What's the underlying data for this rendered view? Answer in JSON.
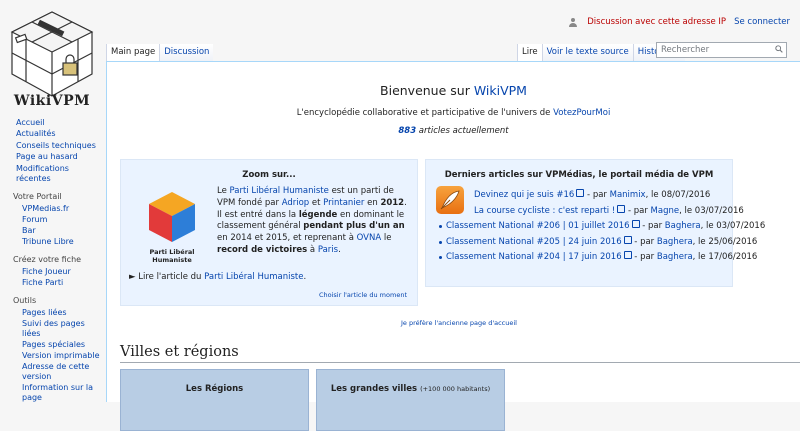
{
  "logo": {
    "wordmark": "WikiVPM"
  },
  "personal": {
    "ip_talk": "Discussion avec cette adresse IP",
    "login": "Se connecter"
  },
  "tabs_left": [
    "Main page",
    "Discussion"
  ],
  "tabs_right": [
    "Lire",
    "Voir le texte source",
    "Historique"
  ],
  "search": {
    "placeholder": "Rechercher"
  },
  "sidebar": {
    "nav": [
      "Accueil",
      "Actualités",
      "Conseils techniques",
      "Page au hasard",
      "Modifications récentes"
    ],
    "portail": {
      "heading": "Votre Portail",
      "items": [
        "VPMedias.fr",
        "Forum",
        "Bar",
        "Tribune Libre"
      ]
    },
    "fiche": {
      "heading": "Créez votre fiche",
      "items": [
        "Fiche Joueur",
        "Fiche Parti"
      ]
    },
    "outils": {
      "heading": "Outils",
      "items": [
        "Pages liées",
        "Suivi des pages liées",
        "Pages spéciales",
        "Version imprimable",
        "Adresse de cette version",
        "Information sur la page"
      ]
    }
  },
  "main": {
    "welcome_prefix": "Bienvenue sur ",
    "welcome_link": "WikiVPM",
    "tagline_prefix": "L'encyclopédie collaborative et participative de l'univers de ",
    "tagline_link": "VotezPourMoi",
    "count_number": "883",
    "count_suffix": " articles actuellement"
  },
  "zoom": {
    "title": "Zoom sur...",
    "logo_caption": "Parti Libéral Humaniste",
    "t1": "Le ",
    "party": "Parti Libéral Humaniste",
    "t2": " est un parti de VPM fondé par ",
    "founder1": "Adriop",
    "t3": " et ",
    "founder2": "Printanier",
    "t4": " en ",
    "year": "2012",
    "t5": ". Il est entré dans la ",
    "legende": "légende",
    "t6": " en dominant le classement général ",
    "duration": "pendant plus d'un an",
    "t7": " en 2014 et 2015, et reprenant à ",
    "ovna": "OVNA",
    "t8": " le ",
    "record": "record de victoires",
    "t9": " à ",
    "paris": "Paris",
    "t10": ".",
    "more_prefix": "► Lire l'article du ",
    "more_link": "Parti Libéral Humaniste",
    "more_suffix": ".",
    "choose": "Choisir l'article du moment"
  },
  "news": {
    "title": "Derniers articles sur VPMédias, le portail média de VPM",
    "items": [
      {
        "link": "Devinez qui je suis #16",
        "by": " - par ",
        "author": "Manimix",
        "date": ", le 08/07/2016"
      },
      {
        "link": "La course cycliste : c'est reparti !",
        "by": " - par ",
        "author": "Magne",
        "date": ", le 03/07/2016"
      },
      {
        "link": "Classement National #206 | 01 juillet 2016",
        "by": " - par ",
        "author": "Baghera",
        "date": ", le 03/07/2016"
      },
      {
        "link": "Classement National #205 | 24 juin 2016",
        "by": " - par ",
        "author": "Baghera",
        "date": ", le 25/06/2016"
      },
      {
        "link": "Classement National #204 | 17 juin 2016",
        "by": " - par ",
        "author": "Baghera",
        "date": ", le 17/06/2016"
      }
    ]
  },
  "old_page": "Je préfère l'ancienne page d'accueil",
  "villes": {
    "heading": "Villes et régions",
    "regions": "Les Régions",
    "villes": "Les grandes villes",
    "villes_note": "(+100 000 habitants)"
  },
  "colors": {
    "link": "#0645ad",
    "redlink": "#ba0000",
    "box": "#eaf3ff",
    "region_box": "#b8cde4"
  }
}
